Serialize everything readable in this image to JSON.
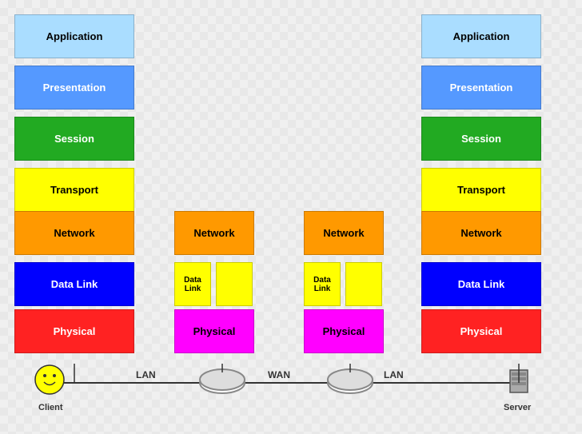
{
  "boxes": {
    "left": {
      "application": "Application",
      "presentation": "Presentation",
      "session": "Session",
      "transport": "Transport",
      "network": "Network",
      "datalink": "Data Link",
      "physical": "Physical"
    },
    "router_left": {
      "network": "Network",
      "datalink1": "Data Link",
      "datalink2": "",
      "physical": "Physical"
    },
    "router_right": {
      "network": "Network",
      "datalink1": "Data Link",
      "datalink2": "",
      "physical": "Physical"
    },
    "right": {
      "application": "Application",
      "presentation": "Presentation",
      "session": "Session",
      "transport": "Transport",
      "network": "Network",
      "datalink": "Data Link",
      "physical": "Physical"
    }
  },
  "labels": {
    "lan_left": "LAN",
    "wan": "WAN",
    "lan_right": "LAN",
    "client": "Client",
    "server": "Server"
  }
}
